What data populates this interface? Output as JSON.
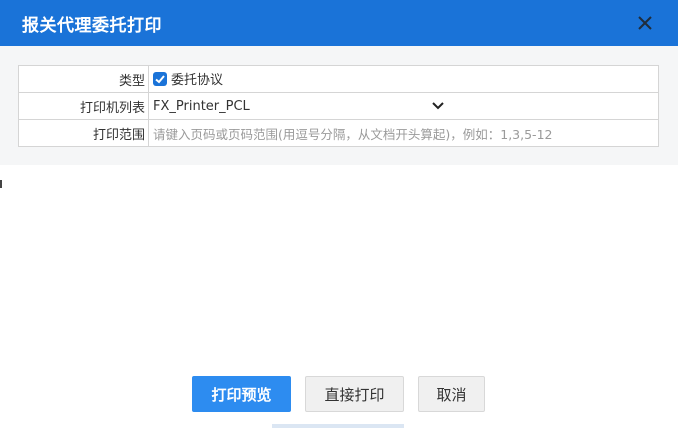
{
  "dialog": {
    "title": "报关代理委托打印"
  },
  "form": {
    "type_label": "类型",
    "type_option": "委托协议",
    "type_checked": true,
    "printer_label": "打印机列表",
    "printer_value": "FX_Printer_PCL",
    "range_label": "打印范围",
    "range_placeholder": "请键入页码或页码范围(用逗号分隔，从文档开头算起)，例如：1,3,5-12"
  },
  "buttons": {
    "preview": "打印预览",
    "print": "直接打印",
    "cancel": "取消"
  },
  "icons": {
    "close": "close-icon",
    "checkbox": "check-icon",
    "dropdown": "chevron-down-icon"
  },
  "colors": {
    "titlebar": "#1a73d8",
    "primary_button": "#2d8cf0"
  }
}
